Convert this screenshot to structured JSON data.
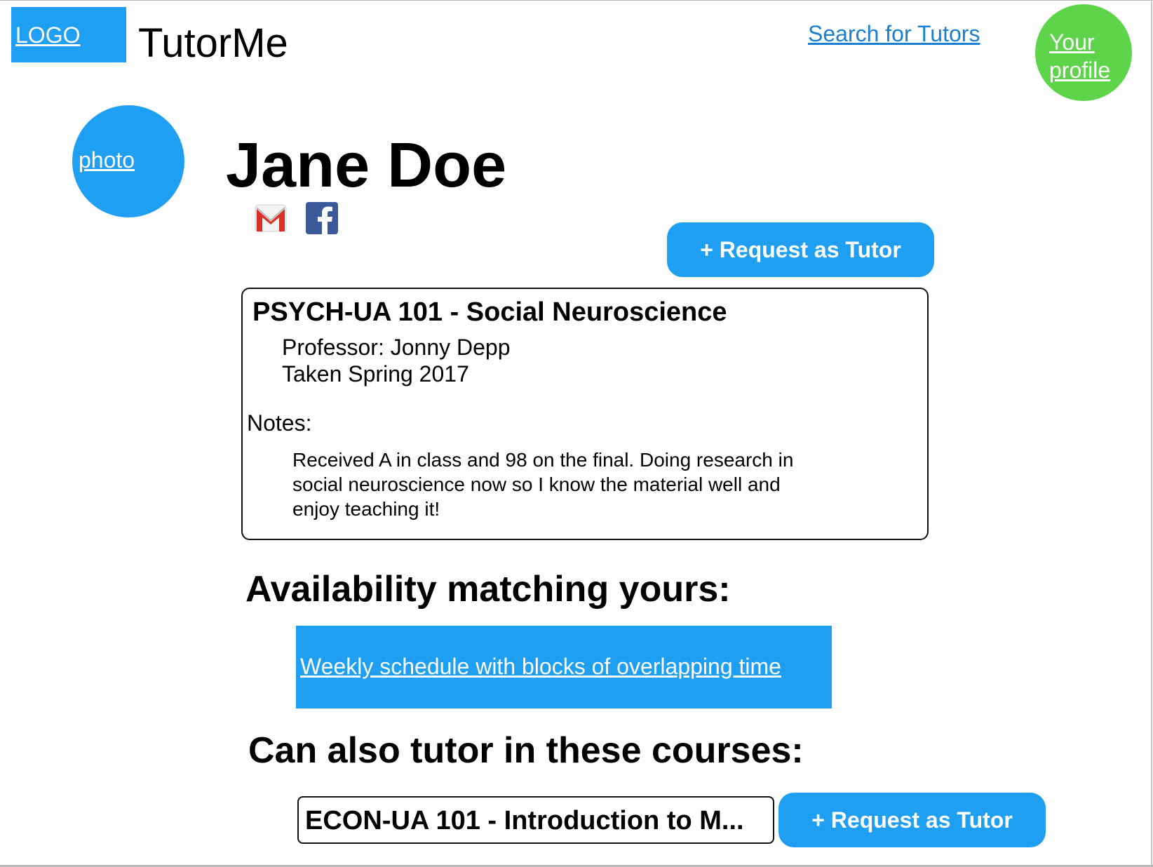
{
  "header": {
    "logo_label": "LOGO",
    "brand": "TutorMe",
    "search_link": "Search for Tutors",
    "profile_link": "Your profile"
  },
  "tutor": {
    "photo_label": "photo",
    "name": "Jane Doe",
    "contact_icons": [
      "gmail-icon",
      "facebook-icon"
    ]
  },
  "actions": {
    "request_label": "+ Request as Tutor"
  },
  "course": {
    "title": "PSYCH-UA 101 - Social Neuroscience",
    "professor": "Professor: Jonny Depp",
    "term": "Taken Spring 2017",
    "notes_label": "Notes:",
    "notes": "Received A in class and 98 on the final. Doing research in social neuroscience now so I know the material well and enjoy teaching it!"
  },
  "availability": {
    "heading": "Availability matching yours:",
    "schedule_link": "Weekly schedule with blocks of overlapping time"
  },
  "other_courses": {
    "heading": "Can also tutor in these courses:",
    "items": [
      {
        "title": "ECON-UA 101 - Introduction to M...",
        "request_label": "+ Request as Tutor"
      }
    ]
  },
  "colors": {
    "accent_blue": "#1e9ff2",
    "profile_green": "#5dd44a",
    "link_blue": "#1a7fd0",
    "gmail_red": "#d93025",
    "facebook_blue": "#3b5998"
  }
}
